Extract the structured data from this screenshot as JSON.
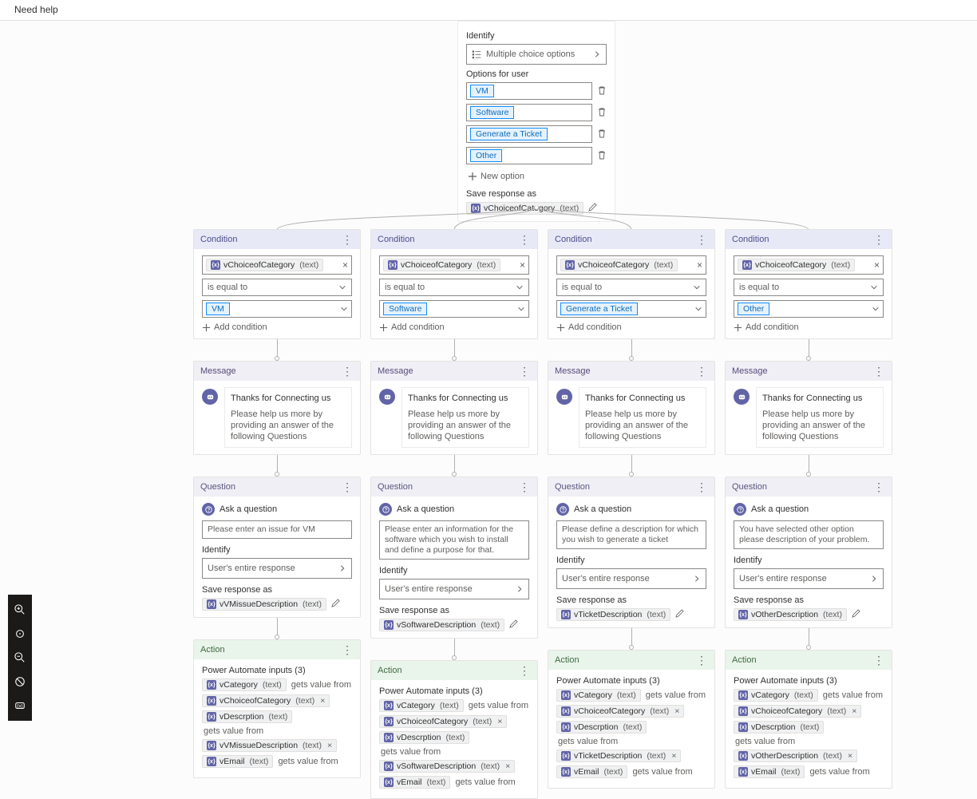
{
  "header": {
    "title": "Need help"
  },
  "main_question": {
    "identify_label": "Identify",
    "identify_value": "Multiple choice options",
    "options_label": "Options for user",
    "options": [
      "VM",
      "Software",
      "Generate a Ticket",
      "Other"
    ],
    "new_option_label": "New option",
    "save_response_label": "Save response as",
    "save_variable_name": "vChoiceofCategory",
    "save_variable_type": "(text)"
  },
  "common": {
    "condition_title": "Condition",
    "cond_variable": "vChoiceofCategory",
    "text_type": "(text)",
    "is_equal": "is equal to",
    "add_condition": "Add condition",
    "message_title": "Message",
    "msg_line1": "Thanks for Connecting us",
    "msg_line2": "Please help us more by providing an answer of the following Questions",
    "question_title": "Question",
    "ask_question": "Ask a question",
    "identify_label": "Identify",
    "identify_value": "User's entire response",
    "save_response": "Save response as",
    "action_title": "Action",
    "pa_inputs": "Power Automate inputs (3)",
    "gets_value": "gets value from",
    "vCategory": "vCategory",
    "vDescrption": "vDescrption",
    "vEmail": "vEmail"
  },
  "branches": [
    {
      "value": "VM",
      "question_prompt": "Please enter an issue for VM",
      "save_var": "vVMissueDescription",
      "desc_src": "vVMissueDescription"
    },
    {
      "value": "Software",
      "question_prompt": "Please enter an information for the software which you wish to install and  define a purpose for that.",
      "save_var": "vSoftwareDescription",
      "desc_src": "vSoftwareDescription"
    },
    {
      "value": "Generate a Ticket",
      "question_prompt": "Please define a description for which you wish to generate a ticket",
      "save_var": "vTicketDescription",
      "desc_src": "vTicketDescription"
    },
    {
      "value": "Other",
      "question_prompt": "You have selected other option please description of your problem.",
      "save_var": "vOtherDescription",
      "desc_src": "vOtherDescription"
    }
  ],
  "zoom_tools": [
    "zoom-in",
    "fit-screen",
    "zoom-out",
    "reset",
    "variables"
  ]
}
